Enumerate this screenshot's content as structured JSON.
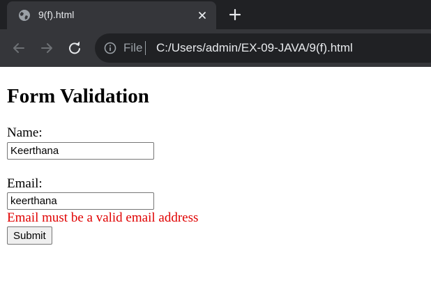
{
  "browser": {
    "tab_title": "9(f).html",
    "scheme_label": "File",
    "url": "C:/Users/admin/EX-09-JAVA/9(f).html"
  },
  "page": {
    "heading": "Form Validation",
    "name_label": "Name:",
    "name_value": "Keerthana",
    "email_label": "Email:",
    "email_value": "keerthana",
    "email_error": "Email must be a valid email address",
    "submit_label": "Submit"
  },
  "colors": {
    "chrome_bg": "#202124",
    "toolbar_bg": "#35363a",
    "error_text": "#e00000"
  },
  "icons": [
    "globe-icon",
    "close-icon",
    "plus-icon",
    "back-arrow-icon",
    "forward-arrow-icon",
    "reload-icon",
    "info-icon"
  ]
}
